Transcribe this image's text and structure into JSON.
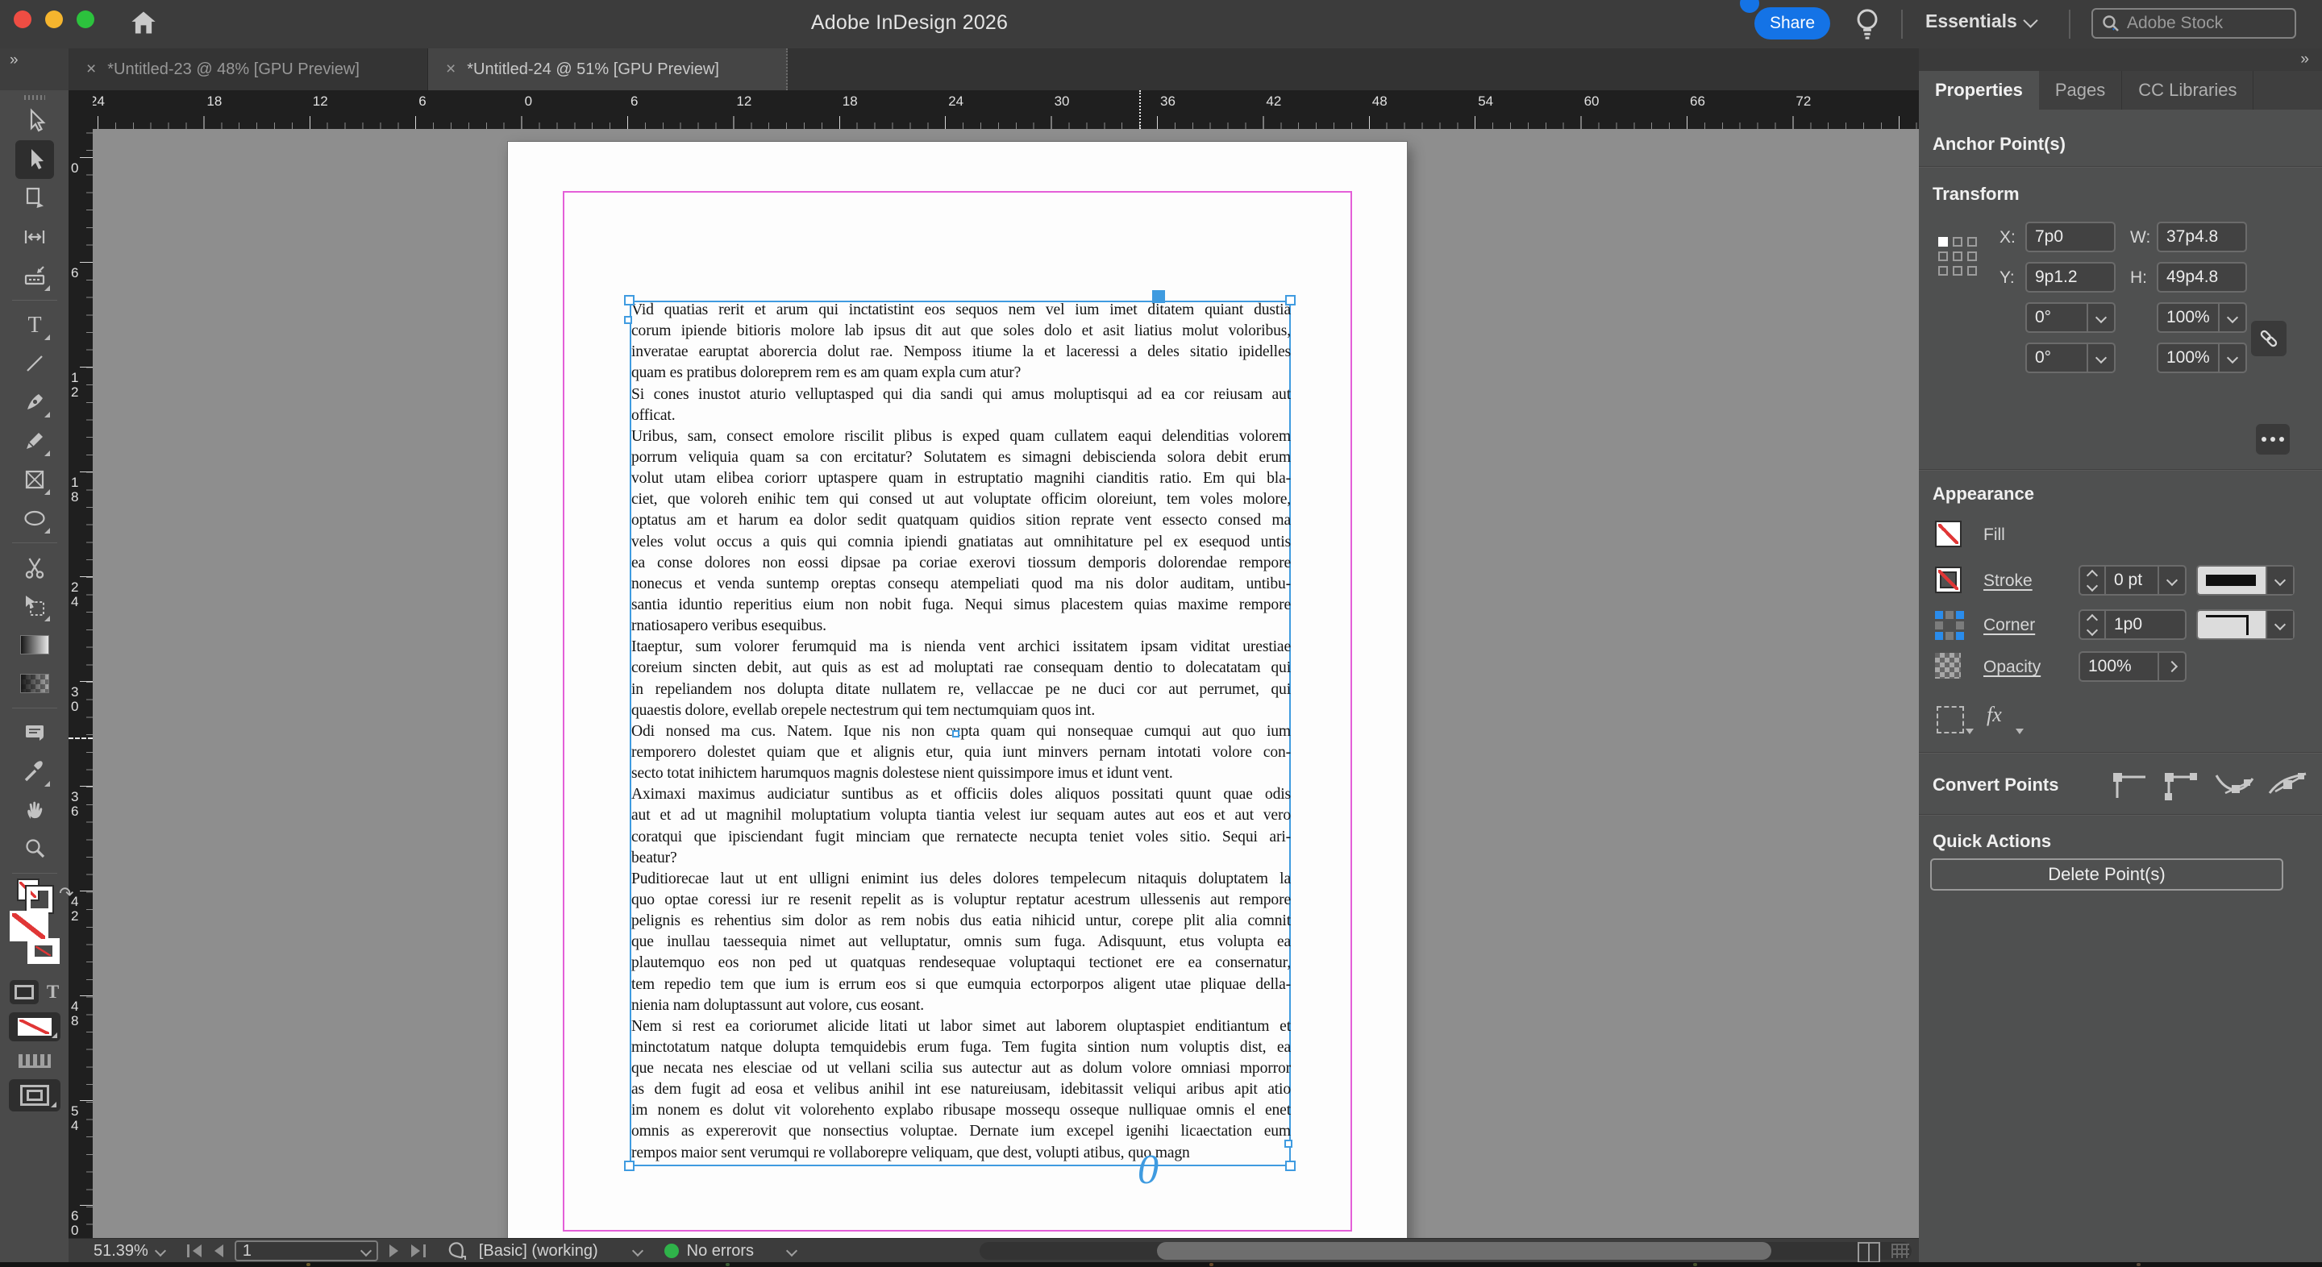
{
  "titlebar": {
    "title": "Adobe InDesign 2026",
    "share_label": "Share",
    "workspace": "Essentials",
    "search_placeholder": "Adobe Stock"
  },
  "doc_tabs": [
    {
      "label": "*Untitled-23 @ 48% [GPU Preview]",
      "active": false
    },
    {
      "label": "*Untitled-24 @ 51% [GPU Preview]",
      "active": true
    }
  ],
  "rulers": {
    "horizontal": [
      "24",
      "18",
      "12",
      "6",
      "0",
      "6",
      "12",
      "18",
      "24",
      "30",
      "36",
      "42",
      "48",
      "54",
      "60",
      "66",
      "72"
    ],
    "vertical": [
      "0",
      "6",
      "12",
      "18",
      "24",
      "30",
      "36",
      "42",
      "48",
      "54",
      "60"
    ]
  },
  "toolbar_tools": [
    "selection-tool",
    "direct-selection-tool",
    "page-tool",
    "gap-tool",
    "content-collector-tool",
    "divider",
    "type-tool",
    "line-tool",
    "pen-tool",
    "pencil-tool",
    "rectangle-frame-tool",
    "ellipse-tool",
    "divider",
    "scissors-tool",
    "free-transform-tool",
    "gradient-swatch-tool",
    "gradient-feather-tool",
    "divider",
    "note-tool",
    "eyedropper-tool",
    "hand-tool",
    "zoom-tool",
    "divider"
  ],
  "toolbar_active_tool": "direct-selection-tool",
  "panel": {
    "tabs": [
      {
        "label": "Properties",
        "active": true
      },
      {
        "label": "Pages",
        "active": false
      },
      {
        "label": "CC Libraries",
        "active": false
      }
    ],
    "selection_header": "Anchor Point(s)",
    "transform": {
      "header": "Transform",
      "x_label": "X:",
      "x_value": "7p0",
      "y_label": "Y:",
      "y_value": "9p1.2",
      "w_label": "W:",
      "w_value": "37p4.8",
      "h_label": "H:",
      "h_value": "49p4.8",
      "rotation_value": "0°",
      "shear_value": "0°",
      "scale_x_value": "100%",
      "scale_y_value": "100%"
    },
    "appearance": {
      "header": "Appearance",
      "fill_label": "Fill",
      "stroke_label": "Stroke",
      "stroke_weight": "0 pt",
      "corner_label": "Corner",
      "corner_value": "1p0",
      "opacity_label": "Opacity",
      "opacity_value": "100%",
      "fx_label": "fx"
    },
    "convert_points_header": "Convert Points",
    "quick_actions_header": "Quick Actions",
    "delete_button_label": "Delete Point(s)"
  },
  "statusbar": {
    "zoom_level": "51.39%",
    "page_number": "1",
    "preflight_profile": "[Basic] (working)",
    "error_status": "No errors"
  },
  "document": {
    "overset_glyph": "0",
    "paragraphs": [
      [
        "Vid quatias rerit et arum qui inctatistint eos sequos nem vel ium imet ditatem quiant dustia",
        "corum ipiende bitioris molore lab ipsus dit aut que soles dolo et asit liatius molut voloribus,",
        "inveratae earuptat aborercia dolut rae. Nemposs itiume la et laceressi a deles sitatio ipidelles",
        "quam es pratibus doloreprem rem es am quam expla cum atur?"
      ],
      [
        "Si cones inustot aturio velluptasped qui dia sandi qui amus moluptisqui ad ea cor reiusam aut",
        "officat."
      ],
      [
        "Uribus, sam, consect emolore riscilit plibus is exped quam cullatem eaqui delenditias volorem",
        "porrum veliquia quam sa con ercitatur? Solutatem es simagni debiscienda solora debit erum",
        "volut utam elibea coriorr uptaspere quam in estruptatio magnihi cianditis ratio. Em qui bla-",
        "ciet, que voloreh enihic tem qui consed ut aut voluptate officim oloreiunt, tem voles molore,",
        "optatus am et harum ea dolor sedit quatquam quidios sition reprate vent essecto consed ma",
        "veles volut occus a quis qui comnia ipiendi gnatiatas aut omnihitature pel ex esequod untis",
        "ea conse dolores non eossi dipsae pa coriae exerovi tiossum demporis dolorendae rempore",
        "nonecus et venda suntemp oreptas consequ atempeliati quod ma nis dolor auditam, untibu-",
        "santia iduntio reperitius eium non nobit fuga. Nequi simus placestem quias maxime rempore",
        "rnatiosapero veribus esequibus."
      ],
      [
        "Itaeptur, sum volorer ferumquid ma is nienda vent archici issitatem ipsam viditat urestiae",
        "coreium sincten debit, aut quis as est ad moluptati rae consequam dentio to dolecatatam qui",
        "in repeliandem nos dolupta ditate nullatem re, vellaccae pe ne duci cor aut perrumet, qui",
        "quaestis dolore, evellab orepele nectestrum qui tem nectumquiam quos int."
      ],
      [
        "Odi nonsed ma cus. Natem. Ique nis non cupta quam qui nonsequae cumqui aut quo ium",
        "remporero dolestet quiam que et alignis etur, quia iunt minvers pernam intotati volore con-",
        "secto totat inihictem harumquos magnis dolestese nient quissimpore imus et idunt vent."
      ],
      [
        "Aximaxi maximus audiciatur suntibus as et officiis doles aliquos possitati quunt quae odis",
        "aut et ad ut magnihil moluptatium volupta tiantia velest iur sequam autes aut eos et aut vero",
        "coratqui que ipisciendant fugit minciam que rernatecte necupta teniet voles sitio. Sequi ari-",
        "beatur?"
      ],
      [
        "Puditiorecae laut ut ent ulligni enimint ius deles dolores tempelecum nitaquis doluptatem la",
        "quo optae coressi iur re resenit repelit as is voluptur reptatur acestrum ullessenis aut rempore",
        "pelignis es rehentius sim dolor as rem nobis dus eatia nihicid untur, corepe plit alia comnit",
        "que inullau taessequia nimet aut velluptatur, omnis sum fuga. Adisquunt, etus volupta ea",
        "plautemquo eos non ped ut quatquas rendesequae voluptaqui tectionet ere ea consernatur,",
        "tem repedio tem que ium is errum eos si que eumquia ectorporpos aligent utae pliquae della-",
        "nienia nam doluptassunt aut volore, cus eosant."
      ],
      [
        "Nem si rest ea coriorumet alicide litati ut labor simet aut laborem oluptaspiet enditiantum et",
        "minctotatum natque dolupta temquidebis erum fuga. Tem fugita sintion num voluptis dist, ea",
        "que necata nes elesciae od ut vellani scilia sus autectur aut as dolum volore omniasi mporror",
        "as dem fugit ad eosa et velibus anihil int ese natureiusam, idebitassit veliqui aribus apit atio",
        "im nonem es dolut vit volorehento explabo ribusape mossequ osseque nulliquae omnis el enet",
        "omnis as expererovit que nonsectius voluptae. Dernate ium excepel igenihi licaectation eum",
        "rempos maior sent verumqui re vollaborepre veliquam, que dest, volupti atibus, quo magn"
      ]
    ]
  },
  "colors": {
    "accent_blue": "#1473e6",
    "selection_blue": "#3f9be0",
    "margin_guide_pink": "#e45fd8",
    "error_ok_green": "#2fb34a",
    "traffic_red": "#ee4d43",
    "traffic_yellow": "#f5b52e",
    "traffic_green": "#2cc23d"
  }
}
